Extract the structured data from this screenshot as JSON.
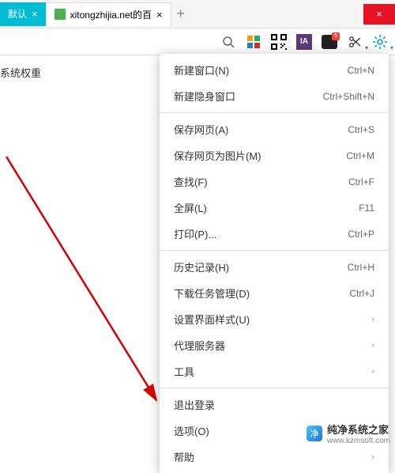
{
  "tabs": {
    "active": {
      "label": "默认",
      "close": "×"
    },
    "second": {
      "label": "xitongzhijia.net的百",
      "close": "×"
    },
    "newtab": "+"
  },
  "window": {
    "close": "×"
  },
  "toolbar": {
    "ia": "IA",
    "notif": "6",
    "gear": "▾"
  },
  "sidebar": {
    "text": "系统权重"
  },
  "menu": {
    "items": [
      {
        "label": "新建窗口(N)",
        "shortcut": "Ctrl+N"
      },
      {
        "label": "新建隐身窗口",
        "shortcut": "Ctrl+Shift+N"
      },
      "---",
      {
        "label": "保存网页(A)",
        "shortcut": "Ctrl+S"
      },
      {
        "label": "保存网页为图片(M)",
        "shortcut": "Ctrl+M"
      },
      {
        "label": "查找(F)",
        "shortcut": "Ctrl+F"
      },
      {
        "label": "全屏(L)",
        "shortcut": "F11"
      },
      {
        "label": "打印(P)...",
        "shortcut": "Ctrl+P"
      },
      "---",
      {
        "label": "历史记录(H)",
        "shortcut": "Ctrl+H"
      },
      {
        "label": "下载任务管理(D)",
        "shortcut": "Ctrl+J"
      },
      {
        "label": "设置界面样式(U)",
        "sub": true
      },
      {
        "label": "代理服务器",
        "sub": true
      },
      {
        "label": "工具",
        "sub": true
      },
      "---",
      {
        "label": "退出登录"
      },
      {
        "label": "选项(O)"
      },
      {
        "label": "帮助",
        "sub": true
      }
    ],
    "chev": "›"
  },
  "watermark": {
    "title": "纯净系统之家",
    "url": "www.kzmsoft.com"
  }
}
